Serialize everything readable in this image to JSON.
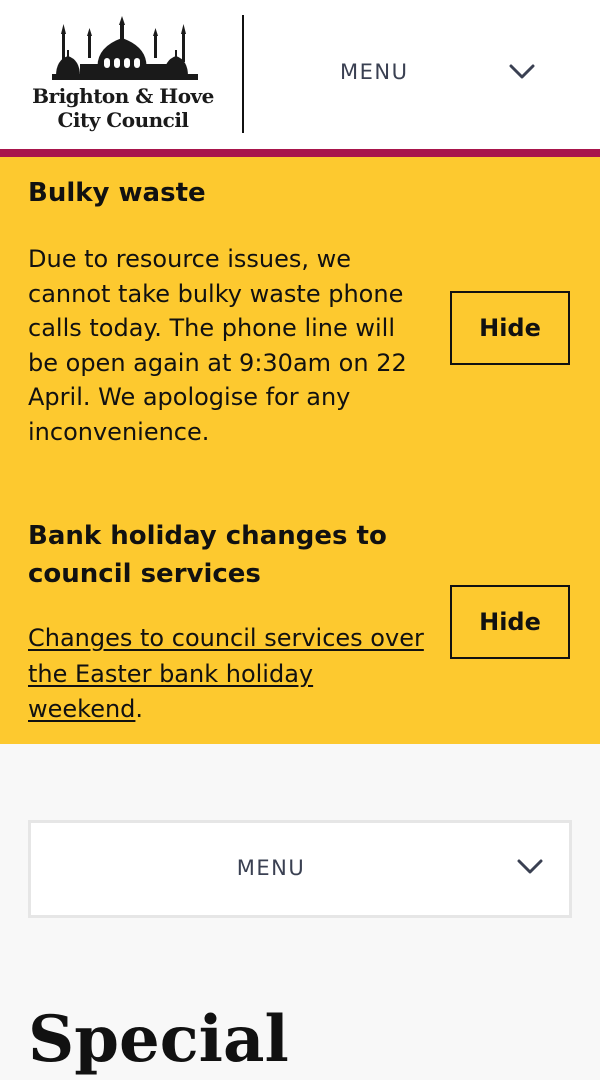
{
  "header": {
    "logo_line1": "Brighton & Hove",
    "logo_line2": "City Council",
    "menu_label": "MENU"
  },
  "alerts": [
    {
      "title": "Bulky waste",
      "body": "Due to resource issues, we cannot take bulky waste phone calls today. The phone line will be open again at 9:30am on 22 April. We apologise for any inconvenience.",
      "hide_label": "Hide"
    },
    {
      "title": "Bank holiday changes to council services",
      "link_text": "Changes to council services over the Easter bank holiday weekend",
      "link_suffix": ".",
      "hide_label": "Hide"
    }
  ],
  "main_menu": {
    "label": "MENU"
  },
  "page": {
    "title": "Special"
  },
  "colors": {
    "alert_background": "#fdc92f",
    "accent_bar": "#a8154c",
    "menu_text": "#3a4052"
  }
}
